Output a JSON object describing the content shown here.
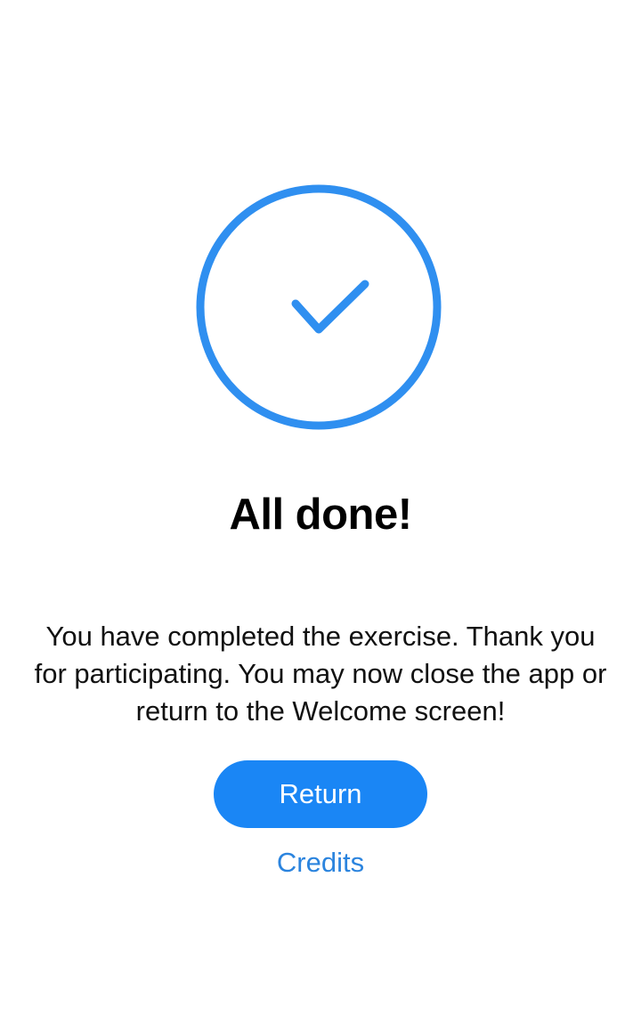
{
  "colors": {
    "accent": "#2f8ff0",
    "button_background": "#1a86f5",
    "link": "#2b84de",
    "background": "#ffffff",
    "title_text": "#000000",
    "body_text": "#111111"
  },
  "status_icon": {
    "name": "checkmark-circle-icon"
  },
  "completion": {
    "title": "All done!",
    "message": "You have completed the exercise. Thank you for participating. You may now close the app or return to the Welcome screen!"
  },
  "actions": {
    "return_label": "Return",
    "credits_label": "Credits"
  }
}
